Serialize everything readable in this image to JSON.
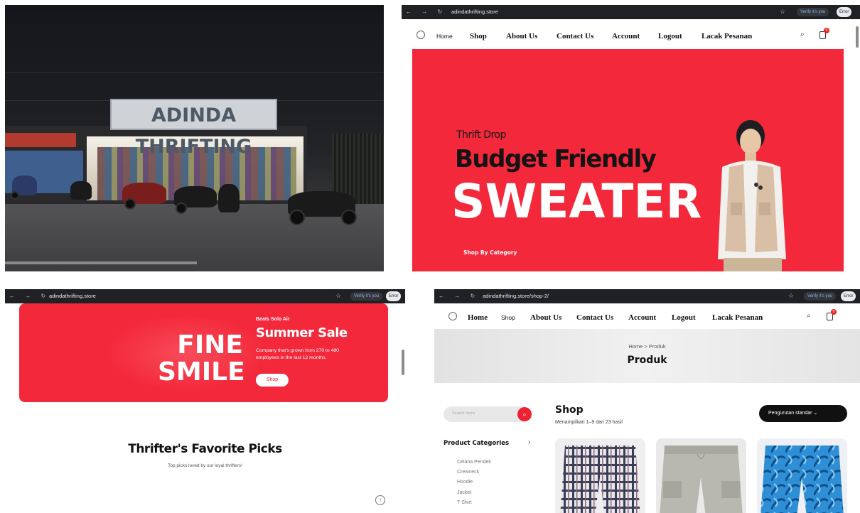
{
  "photo": {
    "store_sign": "ADINDA THRIFTING"
  },
  "hero_window": {
    "browser": {
      "url": "adindathrifting.store",
      "verify_label": "Verify it's you",
      "error_label": "Error"
    },
    "nav": {
      "home": "Home",
      "shop": "Shop",
      "about": "About Us",
      "contact": "Contact Us",
      "account": "Account",
      "logout": "Logout",
      "track": "Lacak Pesanan",
      "cart_count": "0"
    },
    "hero": {
      "kicker": "Thrift Drop",
      "headline": "Budget Friendly",
      "big": "SWEATER",
      "cta": "Shop By Category"
    },
    "colors": {
      "accent": "#f3283a"
    }
  },
  "sale_window": {
    "browser": {
      "url": "adindathrifting.store",
      "verify_label": "Verify it's you",
      "error_label": "Error"
    },
    "banner": {
      "line1": "FINE",
      "line2": "SMILE",
      "brand": "Beats Solo Air",
      "title": "Summer Sale",
      "desc": "Company that's grown from 270 to 480 employees in the last 12 months.",
      "button": "Shop"
    },
    "favorites": {
      "title": "Thrifter's Favorite Picks",
      "subtitle": "Top picks loved by our loyal thrifters!"
    }
  },
  "shop_window": {
    "browser": {
      "url": "adindathrifting.store/shop-2/",
      "verify_label": "Verify it's you",
      "error_label": "Error"
    },
    "nav": {
      "home": "Home",
      "shop": "Shop",
      "about": "About Us",
      "contact": "Contact Us",
      "account": "Account",
      "logout": "Logout",
      "track": "Lacak Pesanan",
      "cart_count": "0"
    },
    "breadcrumb": {
      "home": "Home",
      "sep": ">",
      "current": "Produk"
    },
    "page_title": "Produk",
    "search_placeholder": "Search Items",
    "categories_heading": "Product Categories",
    "categories": [
      "Celana Pendek",
      "Crewneck",
      "Hoodie",
      "Jacket",
      "T-Shirt"
    ],
    "shop_heading": "Shop",
    "result_count": "Menampilkan 1–9 dari 23 hasil",
    "sort_label": "Pengurutan standar",
    "products": [
      {
        "name": "plaid-shorts"
      },
      {
        "name": "grey-cargo-shorts"
      },
      {
        "name": "blue-floral-shorts"
      }
    ]
  }
}
